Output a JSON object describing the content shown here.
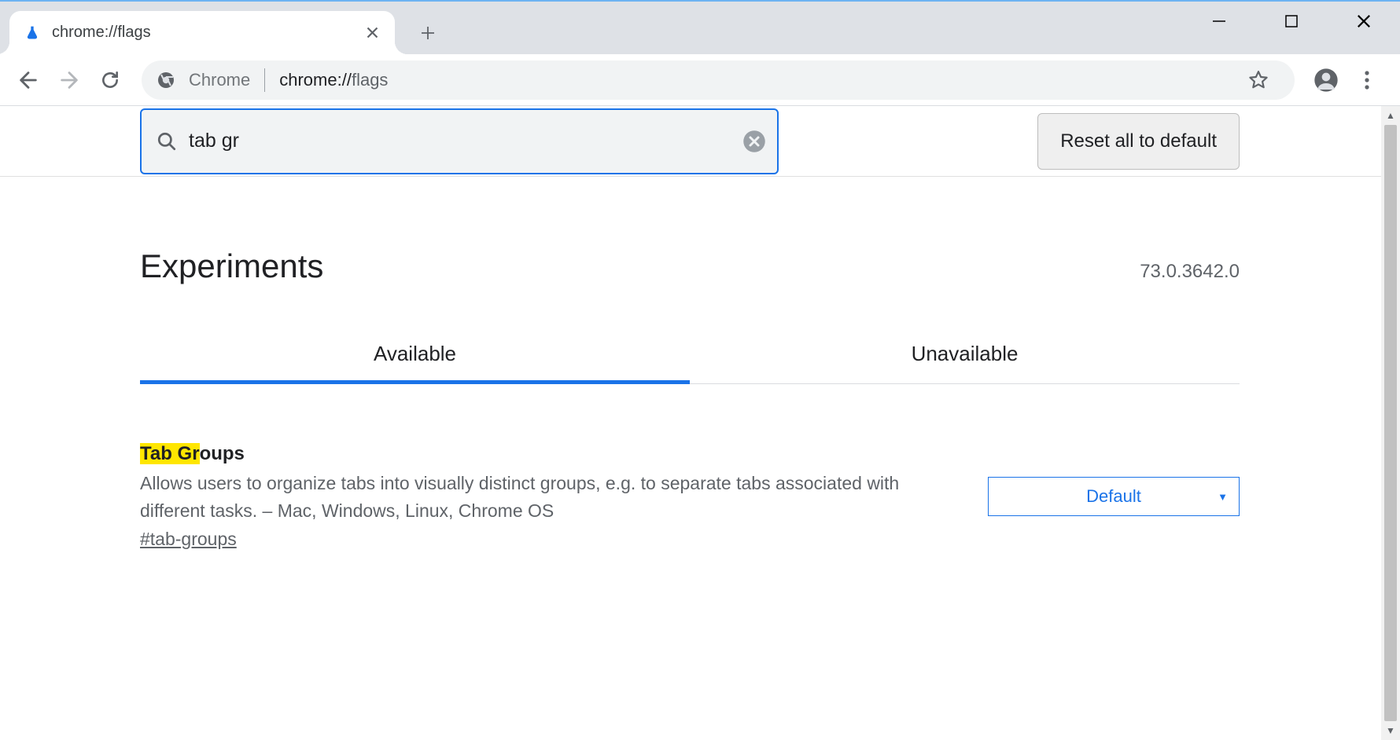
{
  "window": {
    "tab_title": "chrome://flags"
  },
  "omnibox": {
    "product_text": "Chrome",
    "url_scheme": "chrome://",
    "url_host": "flags"
  },
  "flags_page": {
    "search_value": "tab gr",
    "reset_button": "Reset all to default",
    "title": "Experiments",
    "version": "73.0.3642.0",
    "tabs": {
      "available": "Available",
      "unavailable": "Unavailable"
    },
    "experiments": [
      {
        "title_highlight": "Tab Gr",
        "title_rest": "oups",
        "description": "Allows users to organize tabs into visually distinct groups, e.g. to separate tabs associated with different tasks. – Mac, Windows, Linux, Chrome OS",
        "anchor": "#tab-groups",
        "dropdown_value": "Default"
      }
    ]
  }
}
